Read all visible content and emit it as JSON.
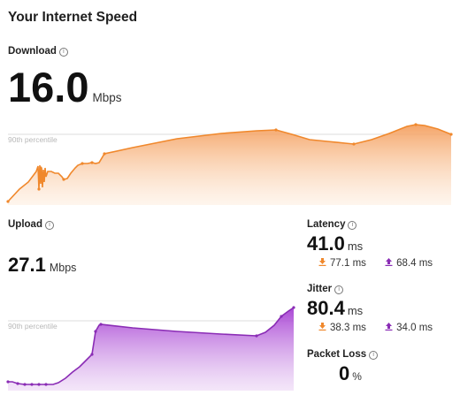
{
  "page_title": "Your Internet Speed",
  "download": {
    "label": "Download",
    "value": "16.0",
    "unit": "Mbps",
    "percentile_label": "90th percentile",
    "color": "#f0882c"
  },
  "upload": {
    "label": "Upload",
    "value": "27.1",
    "unit": "Mbps",
    "percentile_label": "90th percentile",
    "color": "#9b34c8"
  },
  "latency": {
    "label": "Latency",
    "value": "41.0",
    "unit": "ms",
    "down_value": "77.1 ms",
    "up_value": "68.4 ms"
  },
  "jitter": {
    "label": "Jitter",
    "value": "80.4",
    "unit": "ms",
    "down_value": "38.3 ms",
    "up_value": "34.0 ms"
  },
  "packet_loss": {
    "label": "Packet Loss",
    "value": "0",
    "unit": "%"
  },
  "icons": {
    "info": "info-circle-icon",
    "download_arrow": "download-arrow-icon",
    "upload_arrow": "upload-arrow-icon"
  }
}
